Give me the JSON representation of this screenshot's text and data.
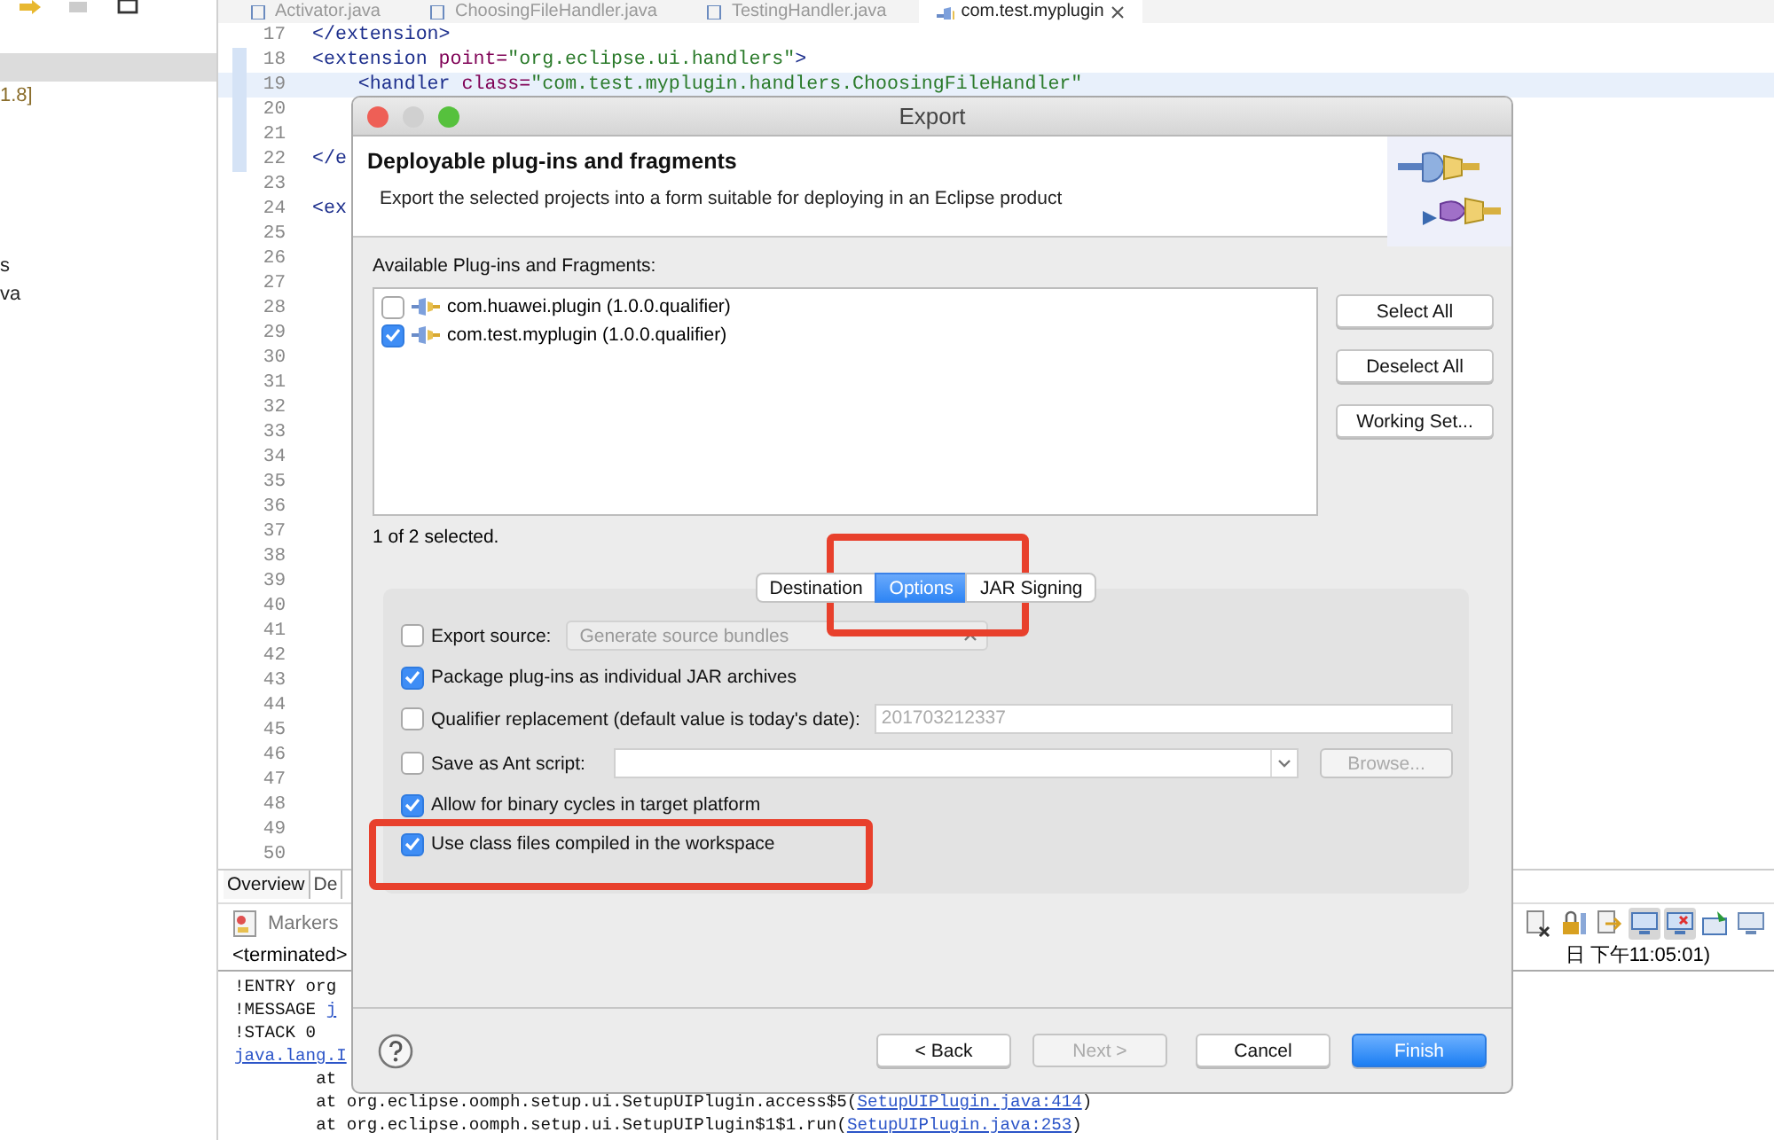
{
  "explorer": {
    "rows": [
      {
        "selected": true
      },
      {
        "text": "1.8]",
        "selected": false
      },
      {
        "text": "s",
        "selected": false
      },
      {
        "text": "va",
        "selected": false
      }
    ]
  },
  "editor": {
    "tabs": [
      {
        "label": "Activator.java",
        "selected": false
      },
      {
        "label": "ChoosingFileHandler.java",
        "selected": false
      },
      {
        "label": "TestingHandler.java",
        "selected": false
      },
      {
        "label": "com.test.myplugin",
        "selected": true
      }
    ],
    "lines": [
      {
        "number": "17",
        "ruler": false,
        "current": false,
        "tokens": [
          {
            "kind": "tag",
            "text": "</extension>"
          }
        ]
      },
      {
        "number": "18",
        "ruler": true,
        "current": false,
        "tokens": [
          {
            "kind": "tag",
            "text": "<extension"
          },
          {
            "kind": "attr",
            "text": " point="
          },
          {
            "kind": "value",
            "text": "\"org.eclipse.ui.handlers\""
          },
          {
            "kind": "tag",
            "text": ">"
          }
        ]
      },
      {
        "number": "19",
        "ruler": true,
        "current": true,
        "tokens": [
          {
            "kind": "tag",
            "text": "    <handler"
          },
          {
            "kind": "attr",
            "text": " class="
          },
          {
            "kind": "value",
            "text": "\"com.test.myplugin.handlers.ChoosingFileHandler\""
          }
        ]
      },
      {
        "number": "20",
        "ruler": true,
        "current": false
      },
      {
        "number": "21",
        "ruler": true,
        "current": false
      },
      {
        "number": "22",
        "ruler": true,
        "current": false,
        "tokens": [
          {
            "kind": "tag",
            "text": "</e"
          }
        ]
      },
      {
        "number": "23",
        "ruler": false,
        "current": false
      },
      {
        "number": "24",
        "ruler": false,
        "current": false,
        "tokens": [
          {
            "kind": "tag",
            "text": "<ex"
          }
        ]
      },
      {
        "number": "25"
      },
      {
        "number": "26"
      },
      {
        "number": "27"
      },
      {
        "number": "28"
      },
      {
        "number": "29"
      },
      {
        "number": "30"
      },
      {
        "number": "31"
      },
      {
        "number": "32"
      },
      {
        "number": "33"
      },
      {
        "number": "34"
      },
      {
        "number": "35"
      },
      {
        "number": "36"
      },
      {
        "number": "37"
      },
      {
        "number": "38"
      },
      {
        "number": "39"
      },
      {
        "number": "40"
      },
      {
        "number": "41"
      },
      {
        "number": "42"
      },
      {
        "number": "43"
      },
      {
        "number": "44"
      },
      {
        "number": "45"
      },
      {
        "number": "46"
      },
      {
        "number": "47"
      },
      {
        "number": "48"
      },
      {
        "number": "49"
      },
      {
        "number": "50"
      }
    ],
    "bottom_tabs": [
      {
        "label": "Overview",
        "selected": true
      },
      {
        "label": "De",
        "selected": false
      }
    ]
  },
  "console": {
    "title": "Markers",
    "header": "<terminated>",
    "header_tail": "日 下午11:05:01)",
    "toolbar": [
      {
        "pressed": false
      },
      {
        "pressed": false
      },
      {
        "pressed": false
      },
      {
        "pressed": true
      },
      {
        "pressed": true
      },
      {
        "pressed": false
      },
      {
        "pressed": false
      }
    ],
    "lines": [
      [
        {
          "text": "!ENTRY org",
          "link": false
        }
      ],
      [
        {
          "text": "!MESSAGE ",
          "link": false
        },
        {
          "text": "j",
          "link": true
        }
      ],
      [
        {
          "text": "!STACK 0",
          "link": false
        }
      ],
      [
        {
          "text": "java.lang.I",
          "link": true
        }
      ],
      [
        {
          "text": "\tat",
          "link": false
        }
      ],
      [
        {
          "text": "\tat org.eclipse.oomph.setup.ui.SetupUIPlugin.access$5(",
          "link": false
        },
        {
          "text": "SetupUIPlugin.java:414",
          "link": true
        },
        {
          "text": ")",
          "link": false
        }
      ],
      [
        {
          "text": "\tat org.eclipse.oomph.setup.ui.SetupUIPlugin$1$1.run(",
          "link": false
        },
        {
          "text": "SetupUIPlugin.java:253",
          "link": true
        },
        {
          "text": ")",
          "link": false
        }
      ]
    ]
  },
  "dialog": {
    "title": "Export",
    "heading": "Deployable plug-ins and fragments",
    "description": "Export the selected projects into a form suitable for deploying in an Eclipse product",
    "list_label": "Available Plug-ins and Fragments:",
    "plugins": [
      {
        "label": "com.huawei.plugin (1.0.0.qualifier)",
        "checked": false
      },
      {
        "label": "com.test.myplugin (1.0.0.qualifier)",
        "checked": true
      }
    ],
    "side_buttons": [
      "Select All",
      "Deselect All",
      "Working Set..."
    ],
    "selection_count": "1 of 2 selected.",
    "tabs": [
      {
        "label": "Destination",
        "selected": false
      },
      {
        "label": "Options",
        "selected": true
      },
      {
        "label": "JAR Signing",
        "selected": false
      }
    ],
    "options": [
      {
        "kind": "combo",
        "label": "Export source:",
        "checked": false,
        "value": "Generate source bundles",
        "disabled": true
      },
      {
        "kind": "plain",
        "label": "Package plug-ins as individual JAR archives",
        "checked": true
      },
      {
        "kind": "field",
        "label": "Qualifier replacement (default value is today's date):",
        "checked": false,
        "value": "201703212337",
        "disabled": true
      },
      {
        "kind": "file",
        "label": "Save as Ant script:",
        "checked": false,
        "button": "Browse...",
        "disabled": true
      },
      {
        "kind": "plain",
        "label": "Allow for binary cycles in target platform",
        "checked": true
      },
      {
        "kind": "plain",
        "label": "Use class files compiled in the workspace",
        "checked": true
      }
    ],
    "buttons": [
      {
        "label": "< Back",
        "kind": "normal",
        "disabled": false
      },
      {
        "label": "Next >",
        "kind": "normal",
        "disabled": true
      },
      {
        "label": "Cancel",
        "kind": "normal",
        "disabled": false
      },
      {
        "label": "Finish",
        "kind": "default",
        "disabled": false
      }
    ]
  }
}
